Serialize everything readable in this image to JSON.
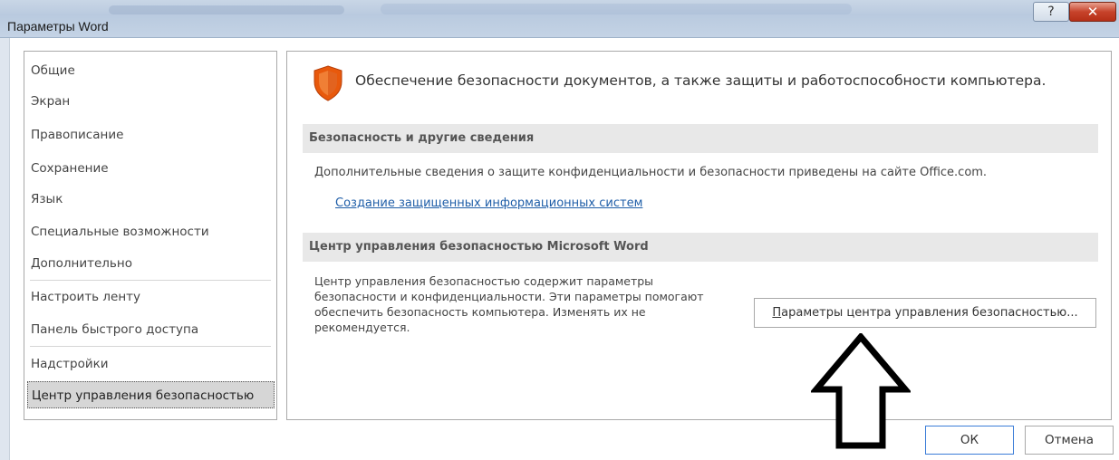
{
  "window": {
    "title": "Параметры Word",
    "help_icon": "help-icon",
    "close_icon": "close-icon",
    "close_color": "#c7432b"
  },
  "sidebar": {
    "items": [
      {
        "label": "Общие"
      },
      {
        "label": "Экран"
      },
      {
        "label": "Правописание"
      },
      {
        "label": "Сохранение"
      },
      {
        "label": "Язык"
      },
      {
        "label": "Специальные возможности"
      },
      {
        "label": "Дополнительно"
      },
      {
        "label": "Настроить ленту"
      },
      {
        "label": "Панель быстрого доступа"
      },
      {
        "label": "Надстройки"
      },
      {
        "label": "Центр управления безопасностью"
      }
    ],
    "selected_index": 10
  },
  "main": {
    "header_text": "Обеспечение безопасности документов, а также защиты и работоспособности компьютера.",
    "header_icon": "shield-icon",
    "shield_color": "#e8590c",
    "security_section": {
      "title": "Безопасность и другие сведения",
      "info_text": "Дополнительные сведения о защите конфиденциальности и безопасности приведены на сайте Office.com.",
      "link_text": "Создание защищенных информационных систем"
    },
    "trust_center_section": {
      "title": "Центр управления безопасностью Microsoft Word",
      "description_lines": [
        "Центр управления безопасностью содержит параметры",
        "безопасности и конфиденциальности. Эти параметры помогают",
        "обеспечить безопасность компьютера. Изменять их не",
        "рекомендуется."
      ],
      "button_hotkey": "П",
      "button_rest": "араметры центра управления безопасностью..."
    }
  },
  "annotation": {
    "arrow_icon": "arrow-up-icon"
  },
  "footer": {
    "ok_label": "ОК",
    "cancel_label": "Отмена",
    "accent": "#3b7dd8"
  }
}
